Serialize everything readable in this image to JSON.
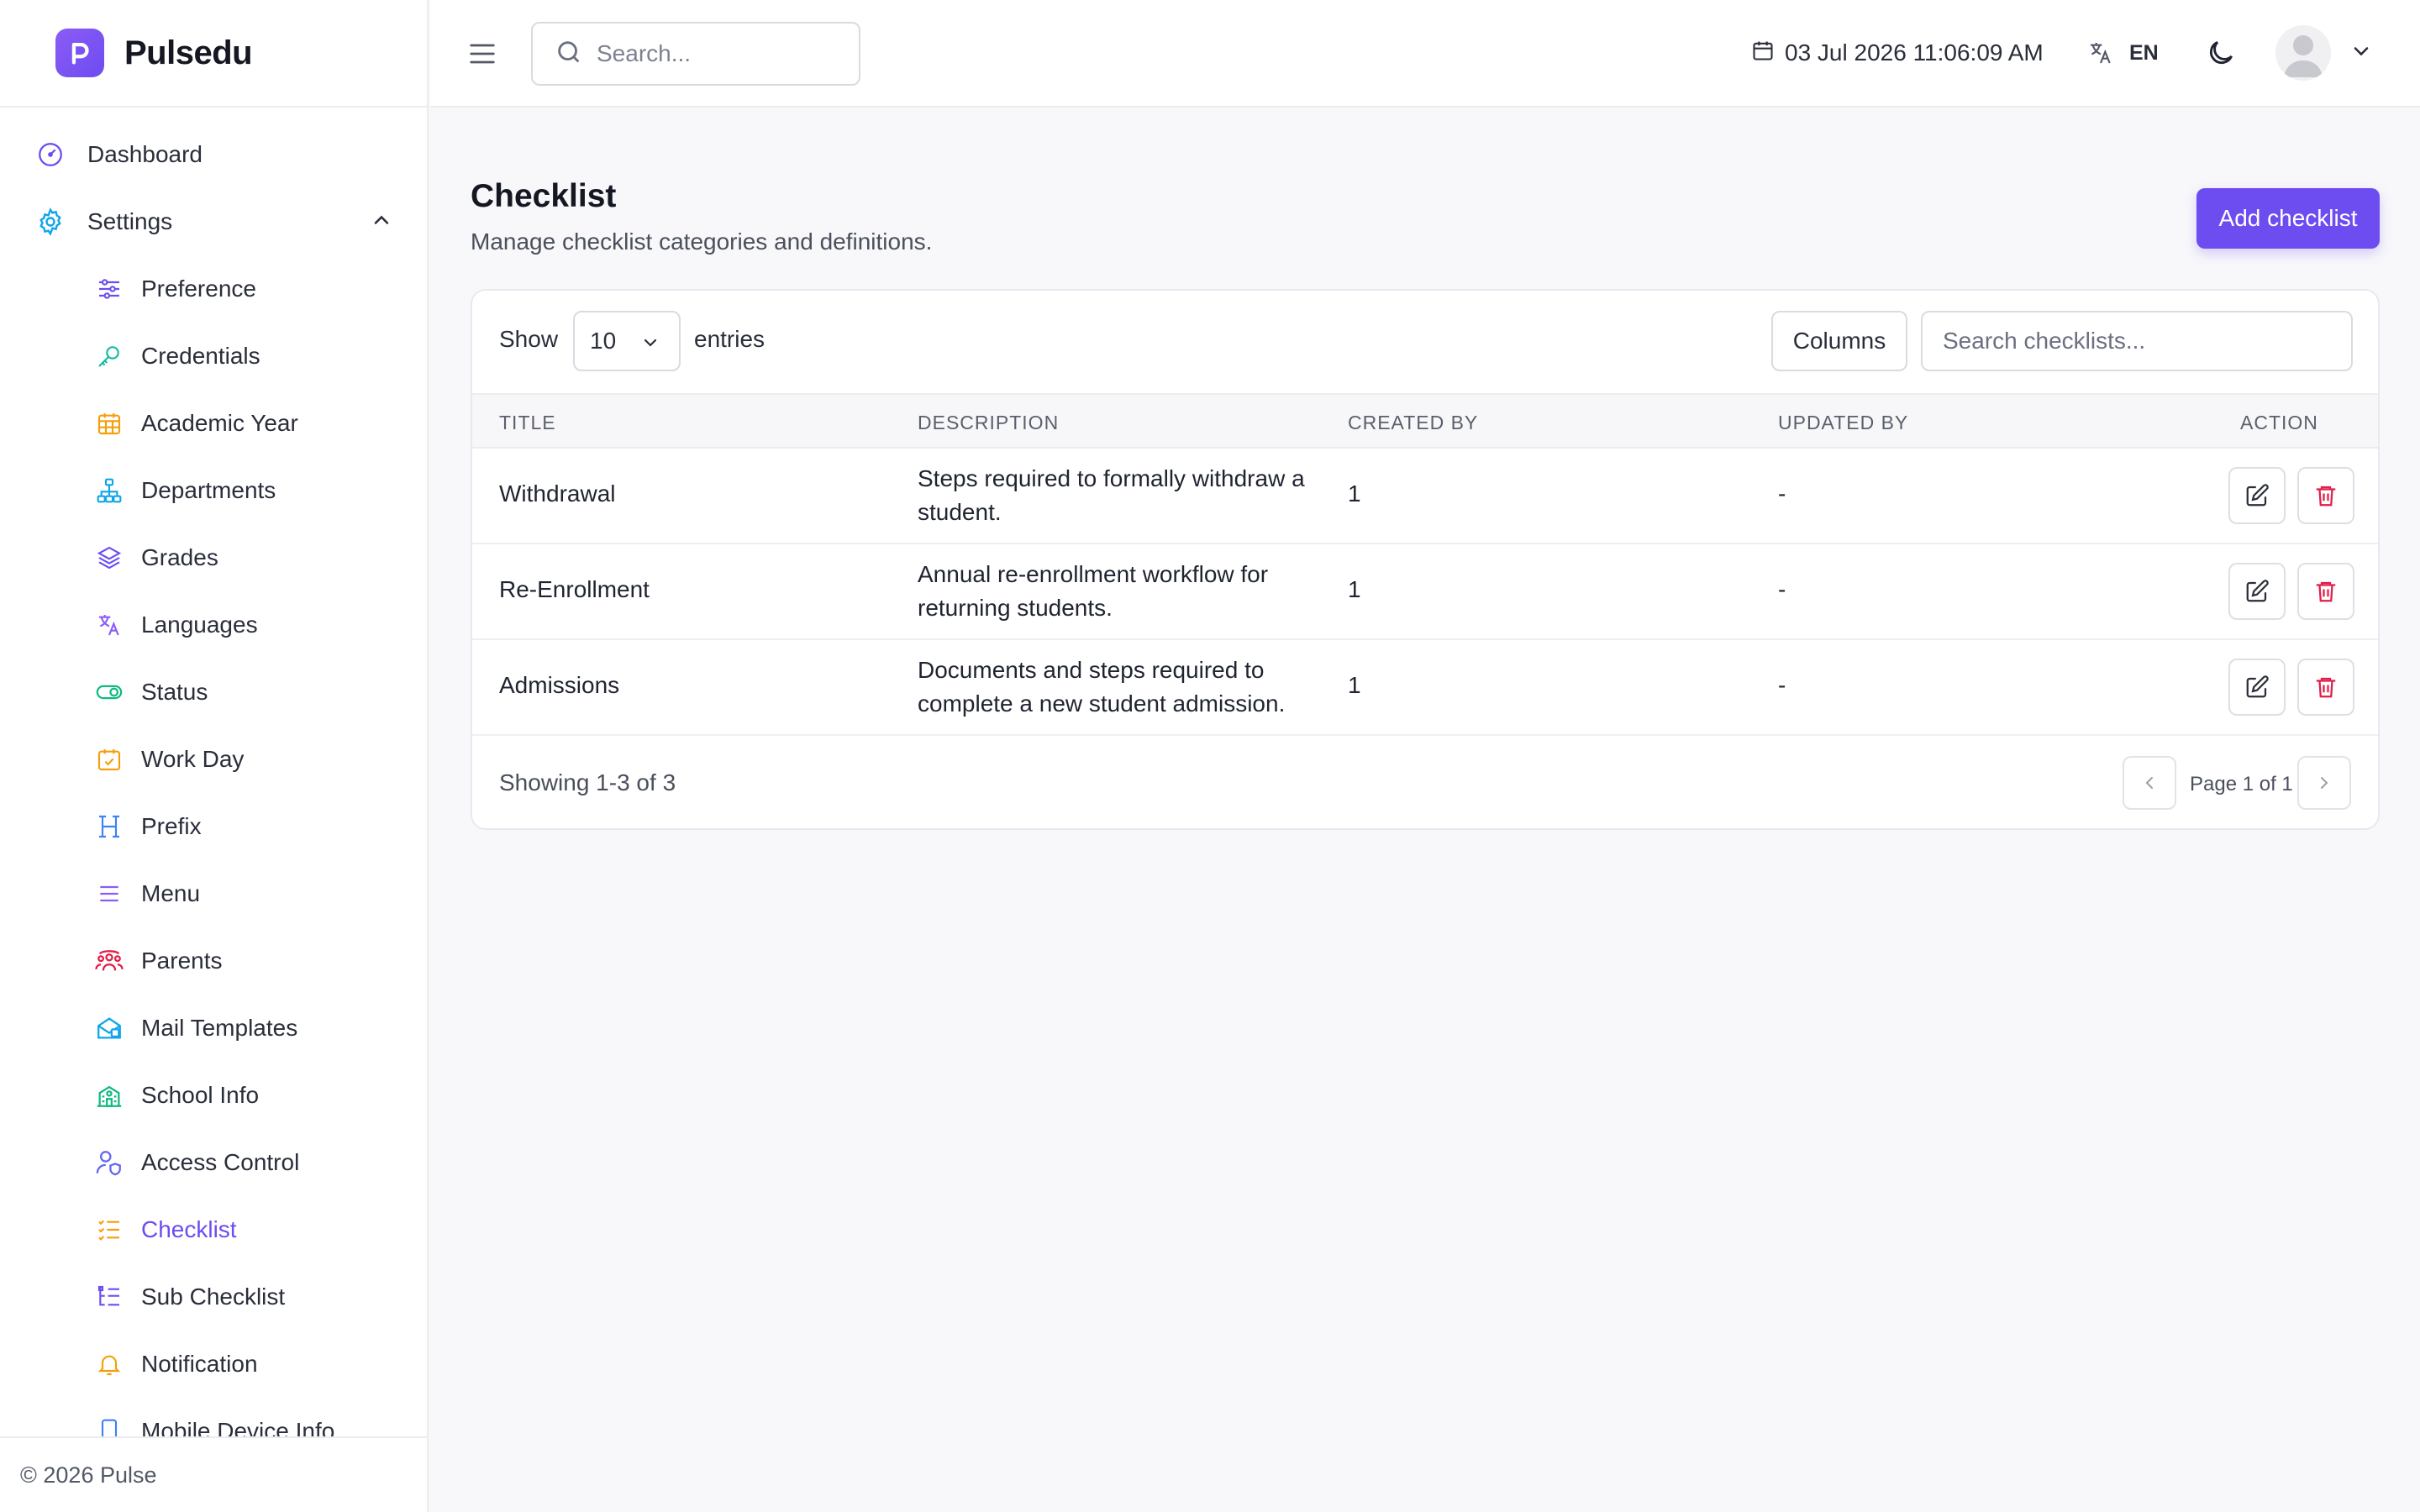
{
  "app": {
    "name": "Pulsedu"
  },
  "header": {
    "search_placeholder": "Search...",
    "datetime": "03 Jul 2026 11:06:09 AM",
    "language": "EN"
  },
  "sidebar": {
    "dashboard": "Dashboard",
    "settings": "Settings",
    "items": [
      {
        "label": "Preference",
        "icon": "sliders-icon",
        "color": "#6d4cf0"
      },
      {
        "label": "Credentials",
        "icon": "key-icon",
        "color": "#14b8a6"
      },
      {
        "label": "Academic Year",
        "icon": "calendar-grid-icon",
        "color": "#f59e0b"
      },
      {
        "label": "Departments",
        "icon": "org-chart-icon",
        "color": "#0ea5e9"
      },
      {
        "label": "Grades",
        "icon": "layers-icon",
        "color": "#6d4cf0"
      },
      {
        "label": "Languages",
        "icon": "translate-icon",
        "color": "#8b5cf6"
      },
      {
        "label": "Status",
        "icon": "toggle-icon",
        "color": "#10b981"
      },
      {
        "label": "Work Day",
        "icon": "calendar-check-icon",
        "color": "#f59e0b"
      },
      {
        "label": "Prefix",
        "icon": "heading-icon",
        "color": "#3b82f6"
      },
      {
        "label": "Menu",
        "icon": "menu-icon",
        "color": "#8b5cf6"
      },
      {
        "label": "Parents",
        "icon": "users-icon",
        "color": "#e11d48"
      },
      {
        "label": "Mail Templates",
        "icon": "mail-icon",
        "color": "#0ea5e9"
      },
      {
        "label": "School Info",
        "icon": "school-icon",
        "color": "#10b981"
      },
      {
        "label": "Access Control",
        "icon": "user-shield-icon",
        "color": "#6366f1"
      },
      {
        "label": "Checklist",
        "icon": "list-check-icon",
        "color": "#f59e0b",
        "active": true
      },
      {
        "label": "Sub Checklist",
        "icon": "list-tree-icon",
        "color": "#6d4cf0"
      },
      {
        "label": "Notification",
        "icon": "bell-icon",
        "color": "#f59e0b"
      },
      {
        "label": "Mobile Device Info",
        "icon": "phone-icon",
        "color": "#3b82f6"
      }
    ],
    "footer": "© 2026 Pulse"
  },
  "page": {
    "title": "Checklist",
    "subtitle": "Manage checklist categories and definitions.",
    "add_button": "Add checklist"
  },
  "table": {
    "show_label": "Show",
    "entries_value": "10",
    "entries_label": "entries",
    "columns_button": "Columns",
    "search_placeholder": "Search checklists...",
    "headers": [
      "TITLE",
      "DESCRIPTION",
      "CREATED BY",
      "UPDATED BY",
      "ACTION"
    ],
    "rows": [
      {
        "title": "Withdrawal",
        "description": "Steps required to formally withdraw a student.",
        "created_by": "1",
        "updated_by": "-"
      },
      {
        "title": "Re-Enrollment",
        "description": "Annual re-enrollment workflow for returning students.",
        "created_by": "1",
        "updated_by": "-"
      },
      {
        "title": "Admissions",
        "description": "Documents and steps required to complete a new student admission.",
        "created_by": "1",
        "updated_by": "-"
      }
    ],
    "showing": "Showing 1-3 of 3",
    "page_label": "Page 1 of 1"
  },
  "colors": {
    "accent": "#6d4cf0",
    "danger": "#e11d48"
  }
}
